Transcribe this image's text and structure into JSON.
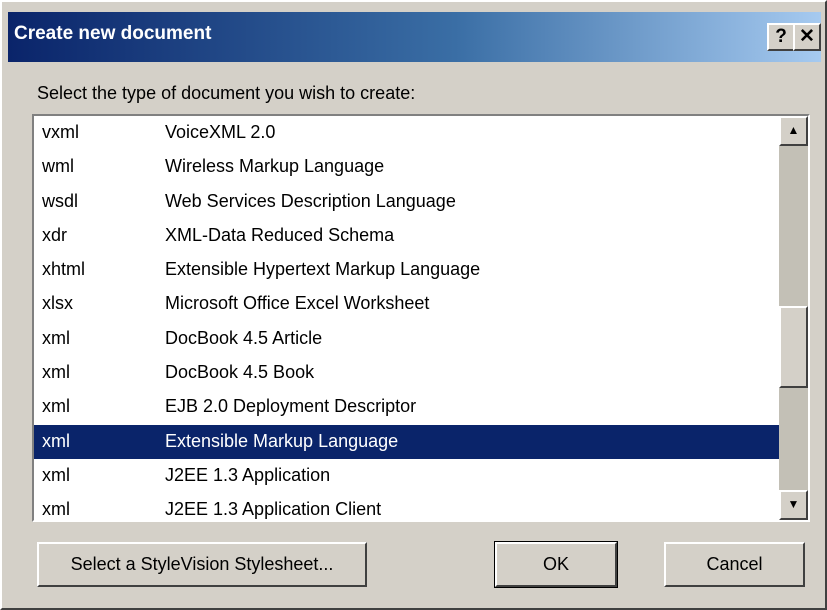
{
  "window": {
    "title": "Create new document",
    "help_label": "?",
    "close_label": "✕"
  },
  "prompt": "Select the type of document you wish to create:",
  "document_types": [
    {
      "ext": "vxml",
      "desc": "VoiceXML 2.0",
      "selected": false
    },
    {
      "ext": "wml",
      "desc": "Wireless Markup Language",
      "selected": false
    },
    {
      "ext": "wsdl",
      "desc": "Web Services Description Language",
      "selected": false
    },
    {
      "ext": "xdr",
      "desc": "XML-Data Reduced Schema",
      "selected": false
    },
    {
      "ext": "xhtml",
      "desc": "Extensible Hypertext Markup Language",
      "selected": false
    },
    {
      "ext": "xlsx",
      "desc": "Microsoft Office Excel Worksheet",
      "selected": false
    },
    {
      "ext": "xml",
      "desc": "DocBook 4.5 Article",
      "selected": false
    },
    {
      "ext": "xml",
      "desc": "DocBook 4.5 Book",
      "selected": false
    },
    {
      "ext": "xml",
      "desc": "EJB 2.0 Deployment Descriptor",
      "selected": false
    },
    {
      "ext": "xml",
      "desc": "Extensible Markup Language",
      "selected": true
    },
    {
      "ext": "xml",
      "desc": "J2EE 1.3 Application",
      "selected": false
    },
    {
      "ext": "xml",
      "desc": "J2EE 1.3 Application Client",
      "selected": false
    }
  ],
  "scrollbar": {
    "up_icon": "▲",
    "down_icon": "▼"
  },
  "buttons": {
    "stylesheet": "Select a StyleVision Stylesheet...",
    "ok": "OK",
    "cancel": "Cancel"
  },
  "colors": {
    "title_bar": "#0a246a",
    "selection": "#0a246a",
    "face": "#d4d0c8"
  }
}
